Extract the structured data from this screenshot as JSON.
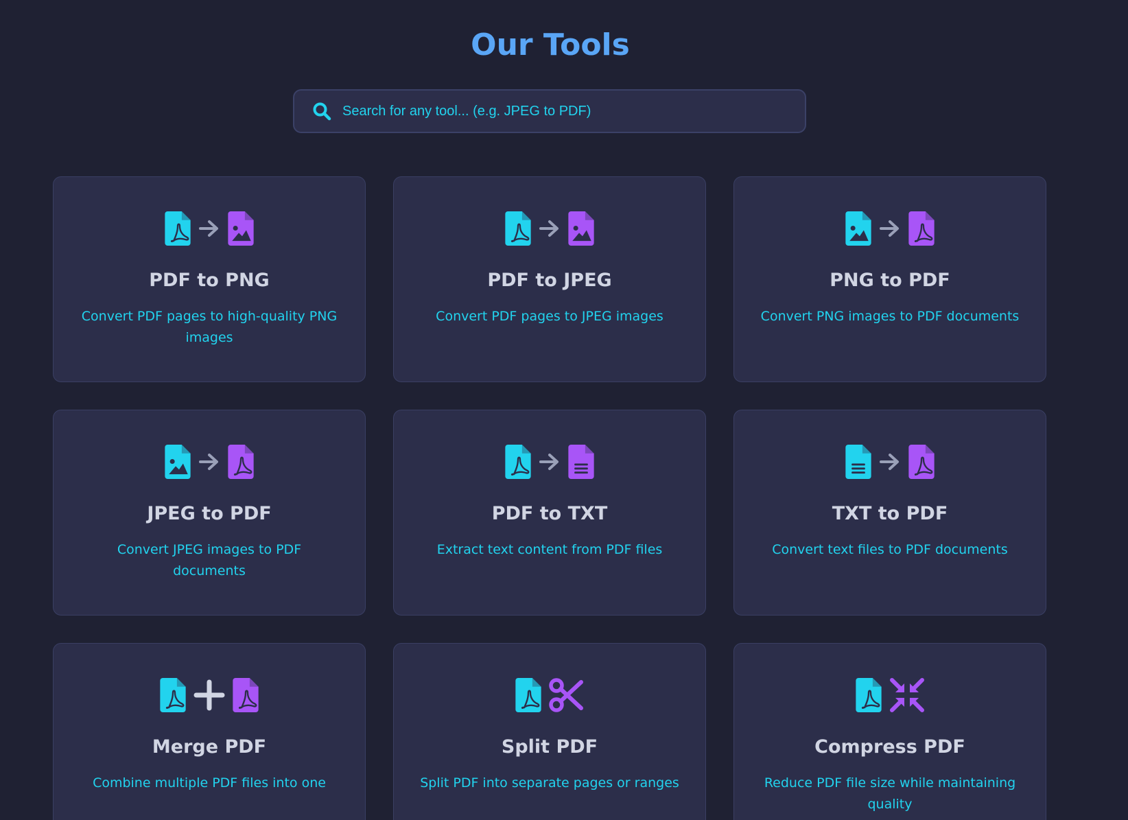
{
  "header": {
    "title": "Our Tools"
  },
  "search": {
    "placeholder": "Search for any tool... (e.g. JPEG to PDF)",
    "icon": "search-icon"
  },
  "colors": {
    "background": "#1f2133",
    "card": "#2c2e4a",
    "title": "#5aa6f6",
    "accent_cyan": "#22d3ee",
    "accent_purple": "#a855f7",
    "card_title": "#d1d5e3"
  },
  "tools": [
    {
      "title": "PDF to PNG",
      "description": "Convert PDF pages to high-quality PNG images",
      "icon_from": "pdf-file-icon",
      "connector": "arrow-right-icon",
      "icon_to": "image-file-icon"
    },
    {
      "title": "PDF to JPEG",
      "description": "Convert PDF pages to JPEG images",
      "icon_from": "pdf-file-icon",
      "connector": "arrow-right-icon",
      "icon_to": "image-file-icon"
    },
    {
      "title": "PNG to PDF",
      "description": "Convert PNG images to PDF documents",
      "icon_from": "image-file-icon",
      "connector": "arrow-right-icon",
      "icon_to": "pdf-file-icon"
    },
    {
      "title": "JPEG to PDF",
      "description": "Convert JPEG images to PDF documents",
      "icon_from": "image-file-icon",
      "connector": "arrow-right-icon",
      "icon_to": "pdf-file-icon"
    },
    {
      "title": "PDF to TXT",
      "description": "Extract text content from PDF files",
      "icon_from": "pdf-file-icon",
      "connector": "arrow-right-icon",
      "icon_to": "text-file-icon"
    },
    {
      "title": "TXT to PDF",
      "description": "Convert text files to PDF documents",
      "icon_from": "text-file-icon",
      "connector": "arrow-right-icon",
      "icon_to": "pdf-file-icon"
    },
    {
      "title": "Merge PDF",
      "description": "Combine multiple PDF files into one",
      "icon_from": "pdf-file-icon",
      "connector": "plus-icon",
      "icon_to": "pdf-file-icon"
    },
    {
      "title": "Split PDF",
      "description": "Split PDF into separate pages or ranges",
      "icon_from": "pdf-file-icon",
      "connector": "none",
      "icon_to": "scissors-icon"
    },
    {
      "title": "Compress PDF",
      "description": "Reduce PDF file size while maintaining quality",
      "icon_from": "pdf-file-icon",
      "connector": "none",
      "icon_to": "compress-icon"
    }
  ]
}
